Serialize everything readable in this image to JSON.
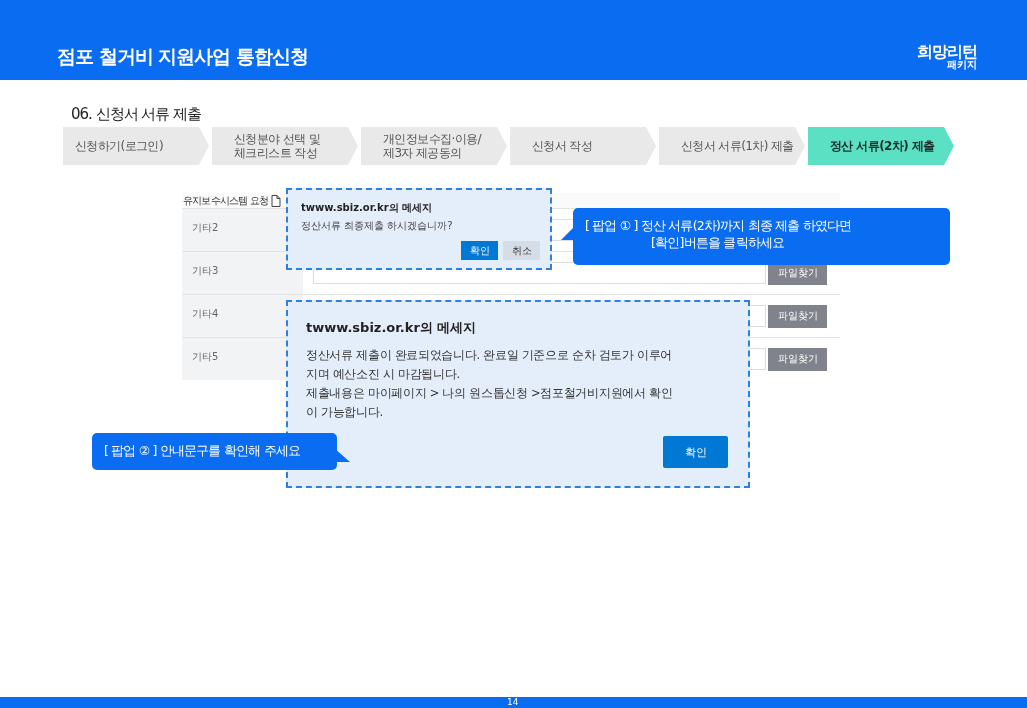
{
  "header": {
    "title": "점포 철거비 지원사업 통합신청",
    "logo": {
      "name": "희망리턴",
      "sub": "패키지"
    }
  },
  "section_title": "06. 신청서 서류 제출",
  "steps": [
    {
      "label": "신청하기(로그인)",
      "selected": false
    },
    {
      "label": "신청분야 선택 및\n체크리스트 작성",
      "selected": false
    },
    {
      "label": "개인정보수집·이용/\n제3자 제공동의",
      "selected": false
    },
    {
      "label": "신청서 작성",
      "selected": false
    },
    {
      "label": "신청서 서류(1차) 제출",
      "selected": false
    },
    {
      "label": "정산 서류(2차) 제출",
      "selected": true
    }
  ],
  "form": {
    "toolbar": "유지보수시스템 요청",
    "rows": [
      {
        "label": "기타2"
      },
      {
        "label": "기타3",
        "button": "파일찾기"
      },
      {
        "label": "기타4",
        "button": "파일찾기"
      },
      {
        "label": "기타5",
        "button": "파일찾기"
      }
    ]
  },
  "popup_1": {
    "title": "twww.sbiz.or.kr의 메세지",
    "message": "정산서류 최종제출 하시겠습니까?",
    "buttons": [
      {
        "label": "확인",
        "kind": "primary"
      },
      {
        "label": "취소",
        "kind": "secondary"
      }
    ]
  },
  "popup_2": {
    "title": "twww.sbiz.or.kr의 메세지",
    "message": "정산서류 제출이 완료되었습니다. 완료일 기준으로 순차 검토가 이루어\n지며 예산소진 시 마감됩니다.\n제출내용은 마이페이지 > 나의 원스톱신청 >점포철거비지원에서 확인\n이 가능합니다.",
    "buttons": [
      {
        "label": "확인",
        "kind": "primary"
      }
    ]
  },
  "callout_1": {
    "lines": [
      "[ 팝업 ① ]  정산 서류(2차)까지 최종 제출 하였다면",
      "[확인]버튼을 클릭하세요"
    ]
  },
  "callout_2": {
    "text": "[ 팝업 ② ] 안내문구를 확인해 주세요"
  },
  "page_number": "14"
}
